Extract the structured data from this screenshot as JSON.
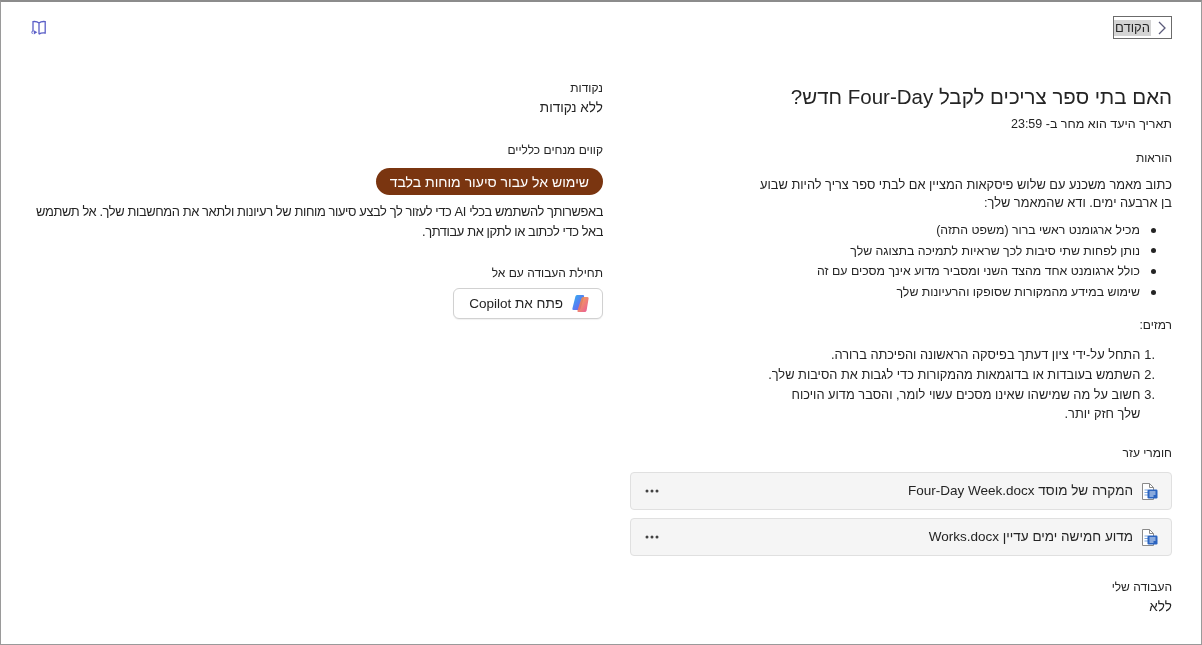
{
  "toolbar": {
    "back_button": {
      "label": "הקודם"
    }
  },
  "assignment": {
    "title": "האם בתי ספר צריכים לקבל Four-Day חדש?",
    "due": "תאריך היעד הוא מחר ב- 23:59",
    "instructions": {
      "heading": "הוראות",
      "text": "כתוב מאמר משכנע עם שלוש פיסקאות המציין אם לבתי ספר צריך להיות שבוע בן ארבעה ימים. ודא שהמאמר שלך:",
      "bullets": [
        "מכיל ארגומנט ראשי ברור (משפט התזה)",
        "נותן לפחות שתי סיבות לכך שראיות לתמיכה בתצוגה שלך",
        "כולל ארגומנט אחד מהצד השני ומסביר מדוע אינך מסכים עם זה",
        "שימוש במידע מהמקורות שסופקו והרעיונות שלך"
      ]
    },
    "hints": {
      "heading": "רמזים:",
      "items": [
        {
          "number": "1.",
          "text": "התחל על-ידי ציון דעתך בפיסקה הראשונה והפיכתה ברורה."
        },
        {
          "number": "2.",
          "text": "השתמש בעובדות או בדוגמאות מהמקורות כדי לגבות את הסיבות שלך."
        },
        {
          "number": "3.",
          "text": "חשוב על מה שמישהו שאינו מסכים עשוי לומר, והסבר מדוע הויכוח שלך חזק יותר."
        }
      ]
    },
    "reference_materials": {
      "heading": "חומרי עזר",
      "files": [
        {
          "name": "המקרה של מוסד Four-Day Week.docx"
        },
        {
          "name": "מדוע חמישה ימים עדיין Works.docx"
        }
      ]
    },
    "my_work": {
      "heading": "העבודה שלי",
      "value": "ללא"
    }
  },
  "sidebar": {
    "points": {
      "heading": "נקודות",
      "value": "ללא נקודות"
    },
    "guidelines": {
      "heading": "קווים מנחים כלליים",
      "badge": "שימוש אל עבור סיעור מוחות בלבד",
      "text": "באפשרותך להשתמש בכלי AI כדי לעזור לך לבצע סיעור מוחות של רעיונות ולתאר את המחשבות שלך. אל תשתמש באל כדי לכתוב או לתקן את עבודתך."
    },
    "ai_start": {
      "heading": "תחילת העבודה עם אל",
      "button": "פתח את Copilot"
    }
  }
}
